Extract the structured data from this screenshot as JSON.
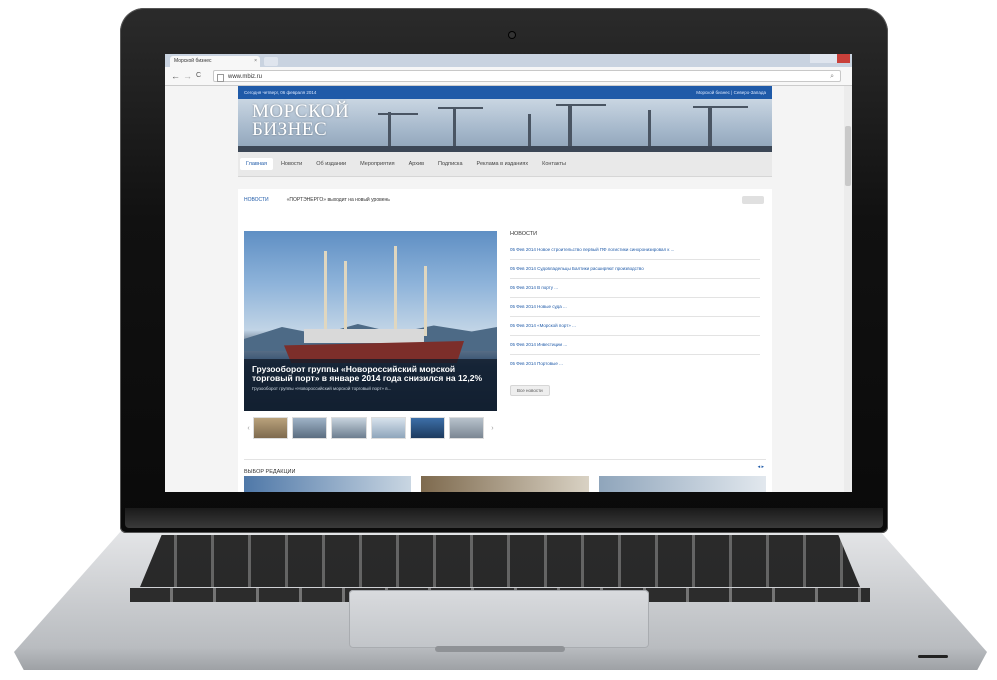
{
  "browser": {
    "tab_title": "Морской бизнес",
    "tab_close": "×",
    "url": "www.mbiz.ru",
    "back_symbol": "←",
    "forward_symbol": "→",
    "reload_symbol": "C",
    "search_symbol": "⌕"
  },
  "site": {
    "top_strip_left": "Сегодня четверг, 06 февраля 2014",
    "top_strip_right": "Морской бизнес | Северо-Запада",
    "logo_line1": "МОРСКОЙ",
    "logo_line2": "БИЗНЕС",
    "menu": [
      "Главная",
      "Новости",
      "Об издании",
      "Мероприятия",
      "Архив",
      "Подписка",
      "Реклама в изданиях",
      "Контакты"
    ],
    "ticker_label": "НОВОСТИ",
    "ticker_text": "«ПОРТЭНЕРГО» выходит на новый уровень",
    "feature_headline": "Грузооборот группы «Новороссийский морской торговый порт» в январе 2014 года снизился на 12,2%",
    "feature_sub": "Грузооборот группы «Новороссийский морской торговый порт» в...",
    "news_heading": "НОВОСТИ",
    "news_items": [
      "05 Фев 2014 Новое строительство первый ПФ логистики синхронизировал к ...",
      "05 Фев 2014 Судовладельцы Балтики расширяют производство",
      "05 Фев 2014 В порту ...",
      "05 Фев 2014 Новые суда ...",
      "05 Фев 2014 «Морской порт» ...",
      "05 Фев 2014 Инвестиции ...",
      "05 Фев 2014 Портовые ..."
    ],
    "all_news_button": "Все новости",
    "editor_choice": "ВЫБОР РЕДАКЦИИ",
    "editor_nav": "◂ ▸"
  },
  "colors": {
    "accent_blue": "#1f5aa8",
    "browser_tabbar": "#c9d3e0"
  },
  "icons": [
    "page-icon",
    "search-icon",
    "back-icon",
    "forward-icon",
    "reload-icon",
    "close-icon"
  ]
}
